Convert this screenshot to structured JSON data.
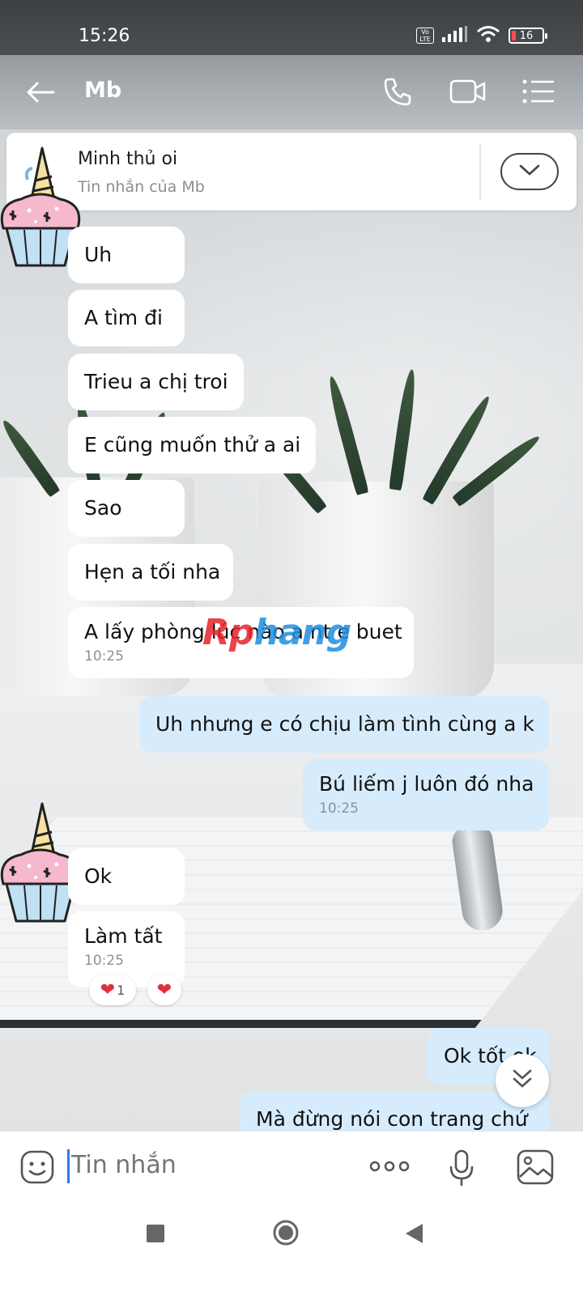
{
  "status_bar": {
    "time": "15:26",
    "network_badge": "Vo LTE",
    "battery_level": "16"
  },
  "header": {
    "contact_name": "Mb",
    "icons": [
      "back-arrow-icon",
      "phone-icon",
      "video-call-icon",
      "menu-list-icon"
    ]
  },
  "pinned": {
    "title": "Minh thủ oi",
    "subtitle": "Tin nhắn của Mb"
  },
  "messages": [
    {
      "dir": "in",
      "text": "Uh"
    },
    {
      "dir": "in",
      "text": "A tìm đi"
    },
    {
      "dir": "in",
      "text": "Trieu a chị troi"
    },
    {
      "dir": "in",
      "text": "E cũng muốn thử a ai"
    },
    {
      "dir": "in",
      "text": "Sao"
    },
    {
      "dir": "in",
      "text": "Hẹn a tối nha"
    },
    {
      "dir": "in",
      "text": "A lấy phòng lúc nào a nt e buet",
      "time": "10:25"
    },
    {
      "dir": "out",
      "text": "Uh nhưng e có chịu làm tình cùng a k"
    },
    {
      "dir": "out",
      "text": "Bú liếm j luôn đó nha",
      "time": "10:25"
    },
    {
      "dir": "in",
      "text": "Ok"
    },
    {
      "dir": "in",
      "text": "Làm tất",
      "time": "10:25"
    },
    {
      "dir": "out",
      "text": "Ok tốt ok"
    },
    {
      "dir": "out",
      "text": "Mà đừng nói con trang chứ"
    }
  ],
  "reactions": {
    "count": "1"
  },
  "watermark": {
    "part_a": "Rp",
    "part_b": "hang"
  },
  "composer": {
    "placeholder": "Tin nhắn"
  },
  "colors": {
    "incoming_bubble": "#ffffff",
    "outgoing_bubble": "#d6ecfd",
    "timestamp": "#8c9196",
    "accent": "#2f7be5",
    "heart": "#e0303d"
  }
}
